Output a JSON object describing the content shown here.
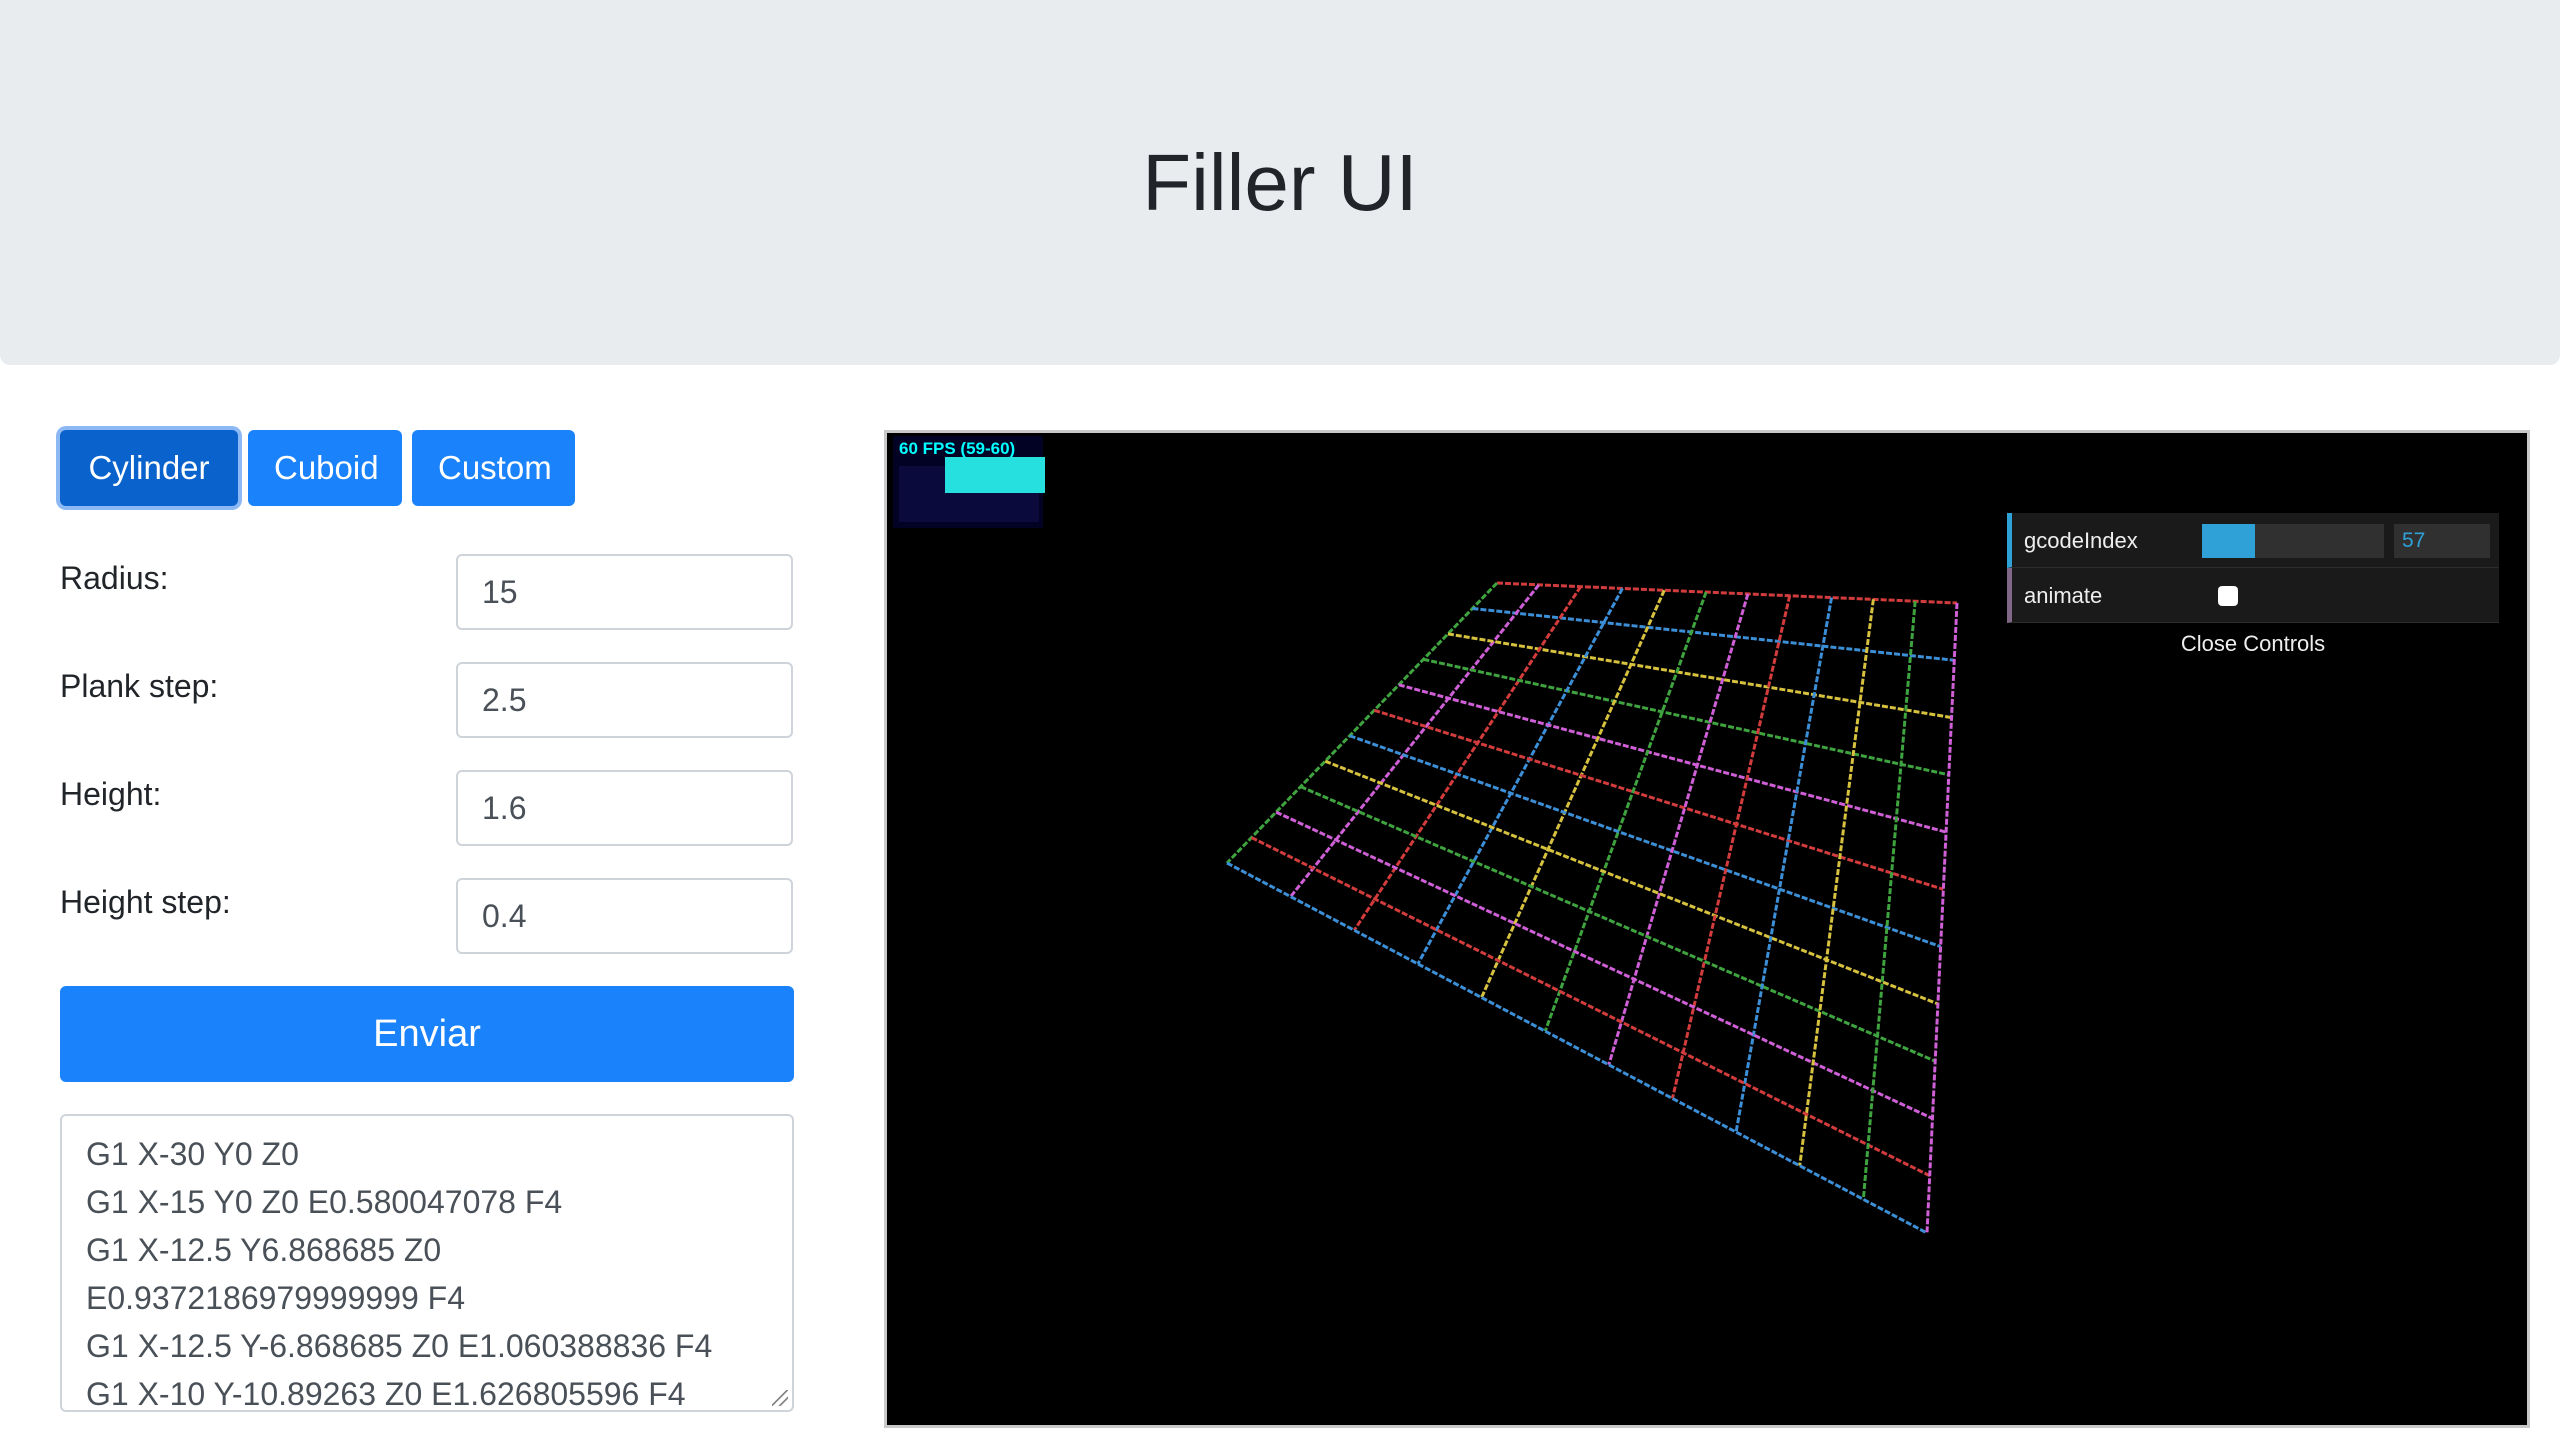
{
  "header": {
    "title": "Filler UI"
  },
  "shape_buttons": [
    {
      "label": "Cylinder",
      "active": true
    },
    {
      "label": "Cuboid",
      "active": false
    },
    {
      "label": "Custom",
      "active": false
    }
  ],
  "form": {
    "fields": [
      {
        "label": "Radius:",
        "value": "15"
      },
      {
        "label": "Plank step:",
        "value": "2.5"
      },
      {
        "label": "Height:",
        "value": "1.6"
      },
      {
        "label": "Height step:",
        "value": "0.4"
      }
    ],
    "submit_label": "Enviar"
  },
  "gcode_lines": [
    "G1 X-30 Y0 Z0",
    "G1 X-15 Y0 Z0 E0.580047078 F4",
    "G1 X-12.5 Y6.868685 Z0",
    "E0.9372186979999999 F4",
    "G1 X-12.5 Y-6.868685 Z0 E1.060388836 F4",
    "G1 X-10 Y-10.89263 Z0 E1.626805596 F4"
  ],
  "viewer": {
    "fps_text": "60 FPS (59-60)",
    "fps_color": "#00ffff",
    "gui": {
      "gcode_index_label": "gcodeIndex",
      "gcode_index_value": "57",
      "gcode_index_fill_fraction": 0.29,
      "animate_label": "animate",
      "animate_checked": false,
      "close_label": "Close Controls"
    },
    "line_colors": [
      "#d23c3c",
      "#3fa33f",
      "#3c8fd6",
      "#cf5fd6",
      "#d6c23f"
    ]
  }
}
